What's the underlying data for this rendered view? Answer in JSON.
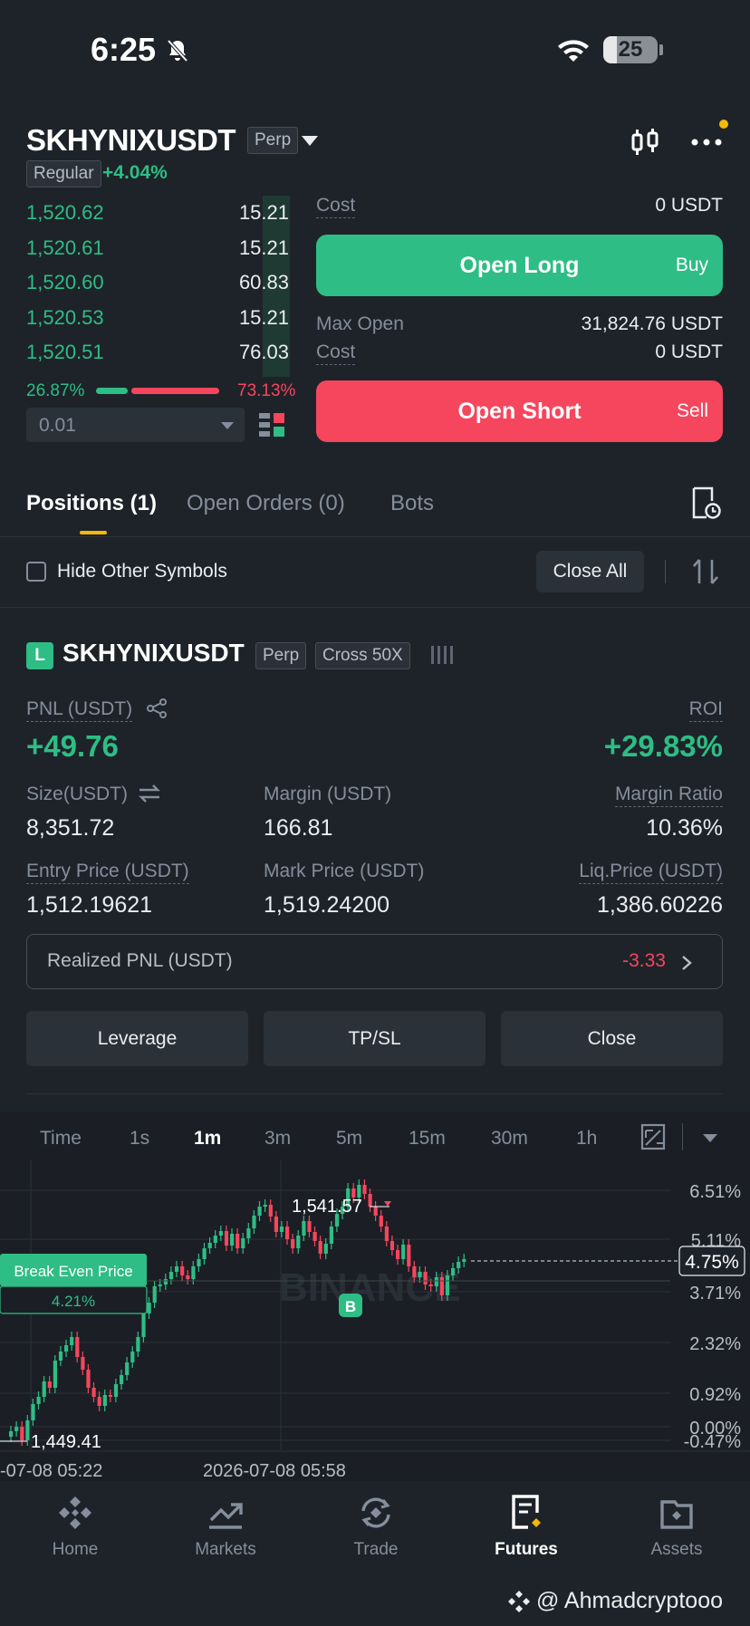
{
  "status_bar": {
    "time": "6:25",
    "battery": "25",
    "battery_level": 0.25
  },
  "header": {
    "symbol": "SKHYNIXUSDT",
    "contract_tag": "Perp",
    "mode_tag": "Regular",
    "change": "+4.04%"
  },
  "order_book": {
    "rows": [
      {
        "price": "1,520.62",
        "amount": "15.21"
      },
      {
        "price": "1,520.61",
        "amount": "15.21"
      },
      {
        "price": "1,520.60",
        "amount": "60.83"
      },
      {
        "price": "1,520.53",
        "amount": "15.21"
      },
      {
        "price": "1,520.51",
        "amount": "76.03"
      }
    ],
    "buy_ratio": "26.87%",
    "sell_ratio": "73.13%",
    "depth_value": "0.01"
  },
  "trade_panel": {
    "cost_label": "Cost",
    "cost_long": "0 USDT",
    "open_long": "Open Long",
    "buy": "Buy",
    "max_open_label": "Max Open",
    "max_open": "31,824.76 USDT",
    "cost_short": "0 USDT",
    "open_short": "Open Short",
    "sell": "Sell"
  },
  "tabs": [
    "Positions (1)",
    "Open Orders (0)",
    "Bots"
  ],
  "filters": {
    "hide_other": "Hide Other Symbols",
    "close_all": "Close All"
  },
  "position": {
    "side": "L",
    "symbol": "SKHYNIXUSDT",
    "tag1": "Perp",
    "tag2": "Cross 50X",
    "pnl_label": "PNL (USDT)",
    "pnl": "+49.76",
    "roi_label": "ROI",
    "roi": "+29.83%",
    "size_label": "Size(USDT)",
    "size": "8,351.72",
    "margin_label": "Margin (USDT)",
    "margin": "166.81",
    "margin_ratio_label": "Margin Ratio",
    "margin_ratio": "10.36%",
    "entry_label": "Entry Price (USDT)",
    "entry": "1,512.19621",
    "mark_label": "Mark Price (USDT)",
    "mark": "1,519.24200",
    "liq_label": "Liq.Price (USDT)",
    "liq": "1,386.60226",
    "realized_label": "Realized PNL (USDT)",
    "realized": "-3.33",
    "buttons": [
      "Leverage",
      "TP/SL",
      "Close"
    ]
  },
  "chart": {
    "timeframes": [
      "Time",
      "1s",
      "1m",
      "3m",
      "5m",
      "15m",
      "30m",
      "1h"
    ],
    "active_timeframe": "1m",
    "high_label": "1,541.57",
    "low_label": "1,449.41",
    "break_even_label": "Break Even Price",
    "break_even_pct": "4.21%",
    "current_pct": "4.75%",
    "buy_marker": "B",
    "watermark": "BINANCE",
    "y_ticks": [
      "6.51%",
      "5.11%",
      "3.71%",
      "2.32%",
      "0.92%",
      "0.00%",
      "-0.47%"
    ],
    "x_ticks": [
      "-07-08 05:22",
      "2026-07-08 05:58"
    ]
  },
  "nav": {
    "items": [
      "Home",
      "Markets",
      "Trade",
      "Futures",
      "Assets"
    ],
    "active": "Futures"
  },
  "credit": "@ Ahmadcryptooo",
  "colors": {
    "up": "#2ebd85",
    "down": "#f6465d",
    "accent": "#f0b90b",
    "bg": "#1e2329"
  }
}
